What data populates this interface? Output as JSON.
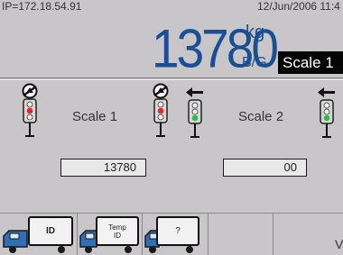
{
  "header": {
    "ip": "IP=172.18.54.91",
    "datetime": "12/Jun/2006 11:4"
  },
  "display": {
    "weight": "13780",
    "unit": "kg",
    "mode": "B/G",
    "active_scale": "Scale 1"
  },
  "scales": [
    {
      "label": "Scale 1",
      "weight": "13780",
      "light_left": "red",
      "light_right": "red"
    },
    {
      "label": "Scale 2",
      "weight": "00",
      "light_left": "green",
      "light_right": "green"
    }
  ],
  "softkeys": {
    "id": "ID",
    "temp_id_line1": "Temp",
    "temp_id_line2": "ID",
    "help": "?",
    "more": "V"
  },
  "icons": [
    "no-entry-icon",
    "traffic-light-red-icon",
    "traffic-light-green-icon",
    "arrow-left-icon",
    "truck-icon"
  ],
  "colors": {
    "background": "#c8c6c8",
    "weight_text": "#1a4f94",
    "badge_bg": "#050505",
    "light_red": "#e32a2a",
    "light_green": "#2cbc48",
    "truck_blue": "#2f6fb4"
  }
}
